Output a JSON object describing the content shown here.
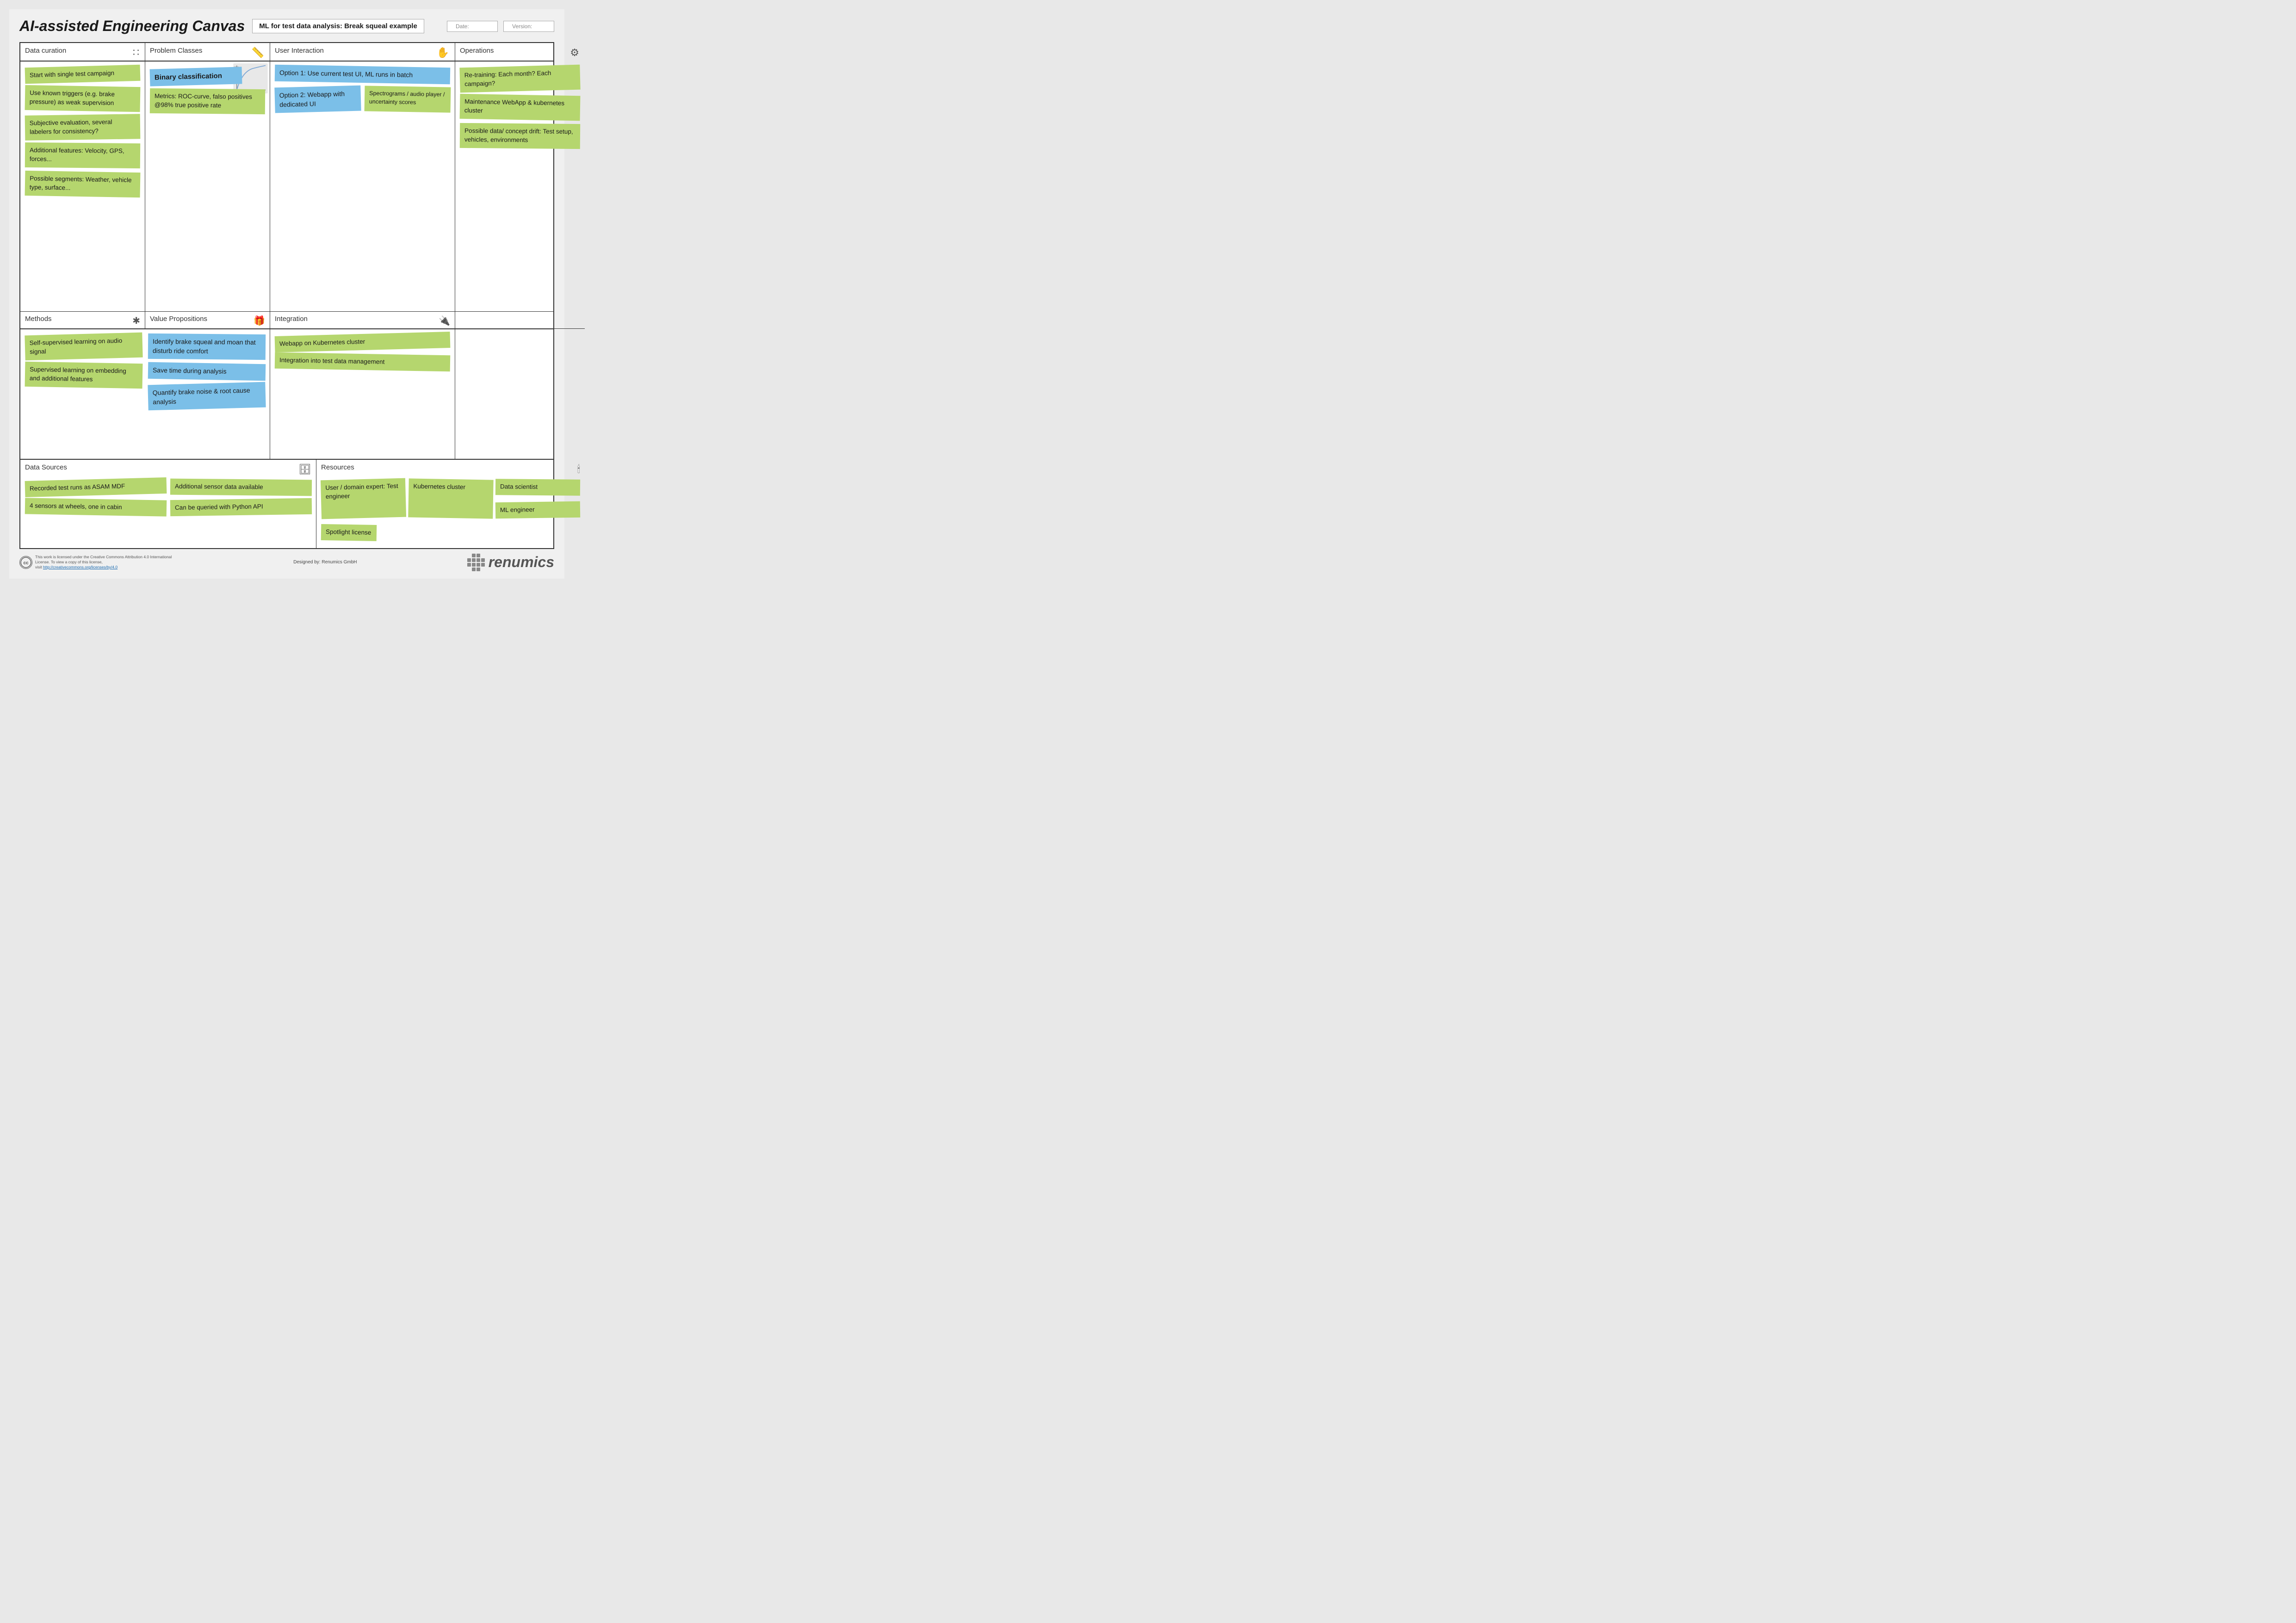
{
  "header": {
    "title": "AI-assisted Engineering Canvas",
    "subtitle": "ML for test data analysis: Break squeal example",
    "date_label": "Date:",
    "version_label": "Version:"
  },
  "sections": {
    "data_curation": {
      "title": "Data curation",
      "notes": [
        "Start with single test campaign",
        "Use known triggers (e.g. brake pressure) as weak supervision",
        "Subjective evaluation, several labelers for consistency?",
        "Additional features: Velocity, GPS, forces...",
        "Possible segments: Weather, vehicle type, surface..."
      ]
    },
    "problem_classes": {
      "title": "Problem Classes",
      "notes": [
        "Binary classification",
        "Metrics: ROC-curve, falso positives @98% true positive rate"
      ]
    },
    "user_interaction": {
      "title": "User Interaction",
      "notes": [
        "Option 1: Use current test UI, ML runs in batch",
        "Option 2: Webapp with dedicated UI",
        "Spectrograms / audio player / uncertainty scores"
      ]
    },
    "operations": {
      "title": "Operations",
      "notes": [
        "Re-training: Each month? Each campaign?",
        "Maintenance WebApp & kubernetes cluster",
        "Possible data/ concept drift: Test setup, vehicles, environments"
      ]
    },
    "methods": {
      "title": "Methods",
      "notes": [
        "Self-supervised learning on audio signal",
        "Supervised learning on embedding and additional features"
      ]
    },
    "value_propositions": {
      "title": "Value Propositions",
      "notes": [
        "Identify brake squeal and moan that disturb ride comfort",
        "Save time during analysis",
        "Quantify brake noise & root cause analysis"
      ]
    },
    "integration": {
      "title": "Integration",
      "notes": [
        "Webapp on Kubernetes cluster",
        "Integration into test data management"
      ]
    },
    "data_sources": {
      "title": "Data Sources",
      "notes": [
        "Recorded test runs as ASAM MDF",
        "4 sensors at wheels, one in cabin",
        "Additional sensor data available",
        "Can be queried with Python API"
      ]
    },
    "resources": {
      "title": "Resources",
      "notes": [
        "User / domain expert: Test engineer",
        "Kubernetes cluster",
        "Data scientist",
        "ML engineer",
        "Spotlight license"
      ]
    }
  },
  "footer": {
    "license_text": "This work is licensed under the Creative Commons Attribution 4.0 International License. To view a copy of this license,",
    "license_url": "http://creativecommons.org/licenses/by/4.0",
    "designed_by": "Designed by: Renumics GmbH",
    "logo_name": "renumics"
  }
}
